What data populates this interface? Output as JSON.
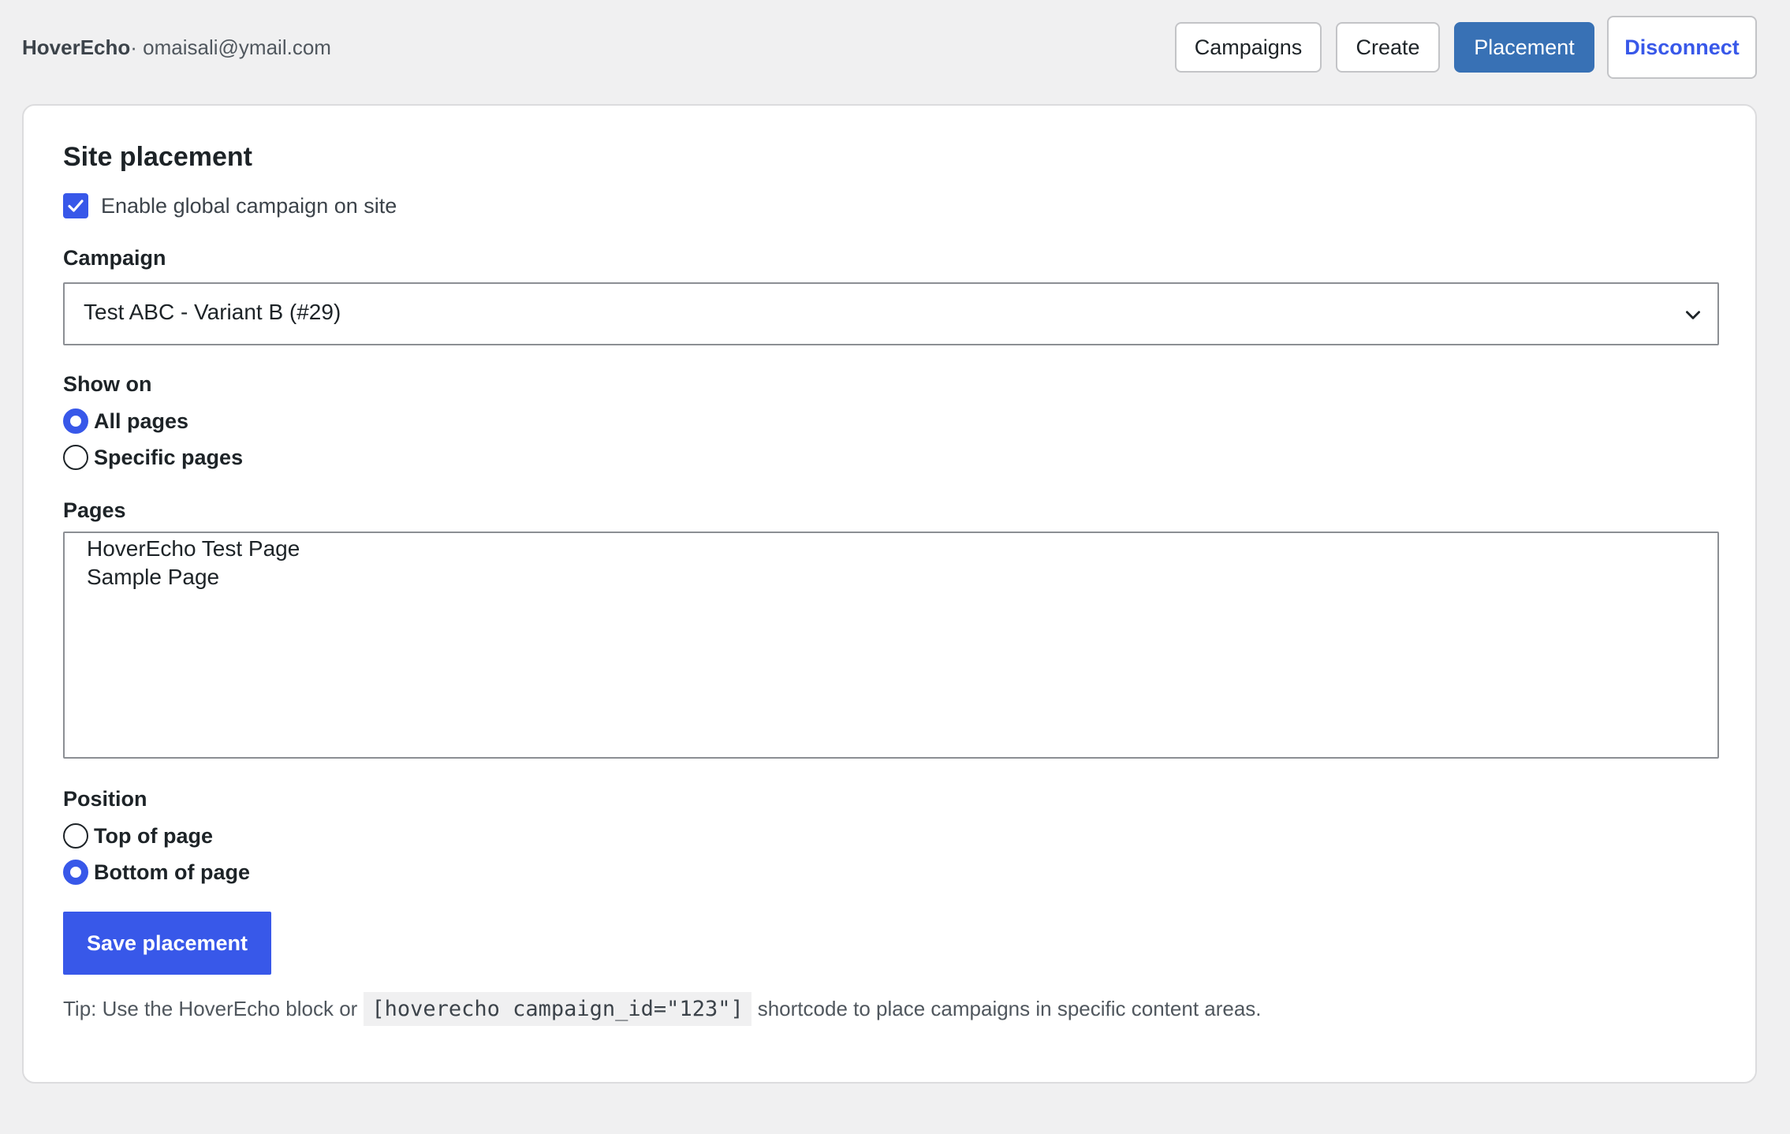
{
  "header": {
    "brand": "HoverEcho",
    "separator": "·",
    "email": "omaisali@ymail.com",
    "nav": [
      {
        "label": "Campaigns",
        "state": "default"
      },
      {
        "label": "Create",
        "state": "default"
      },
      {
        "label": "Placement",
        "state": "active"
      },
      {
        "label": "Disconnect",
        "state": "outline"
      }
    ]
  },
  "placement": {
    "title": "Site placement",
    "enable_global_label": "Enable global campaign on site",
    "enable_global_checked": true,
    "campaign_label": "Campaign",
    "campaign_selected": "Test ABC - Variant B (#29)",
    "show_on_label": "Show on",
    "show_on_options": [
      {
        "label": "All pages",
        "checked": true
      },
      {
        "label": "Specific pages",
        "checked": false
      }
    ],
    "pages_label": "Pages",
    "pages_options": [
      "HoverEcho Test Page",
      "Sample Page"
    ],
    "position_label": "Position",
    "position_options": [
      {
        "label": "Top of page",
        "checked": false
      },
      {
        "label": "Bottom of page",
        "checked": true
      }
    ],
    "save_label": "Save placement",
    "tip_prefix": "Tip: Use the HoverEcho block or",
    "tip_code": "[hoverecho campaign_id=\"123\"]",
    "tip_suffix": "shortcode to place campaigns in specific content areas."
  },
  "colors": {
    "accent": "#3858e9",
    "active_nav": "#3871b5",
    "page_bg": "#f0f0f1"
  },
  "icons": {
    "checkbox": "checkmark-icon",
    "select": "chevron-down-icon"
  }
}
